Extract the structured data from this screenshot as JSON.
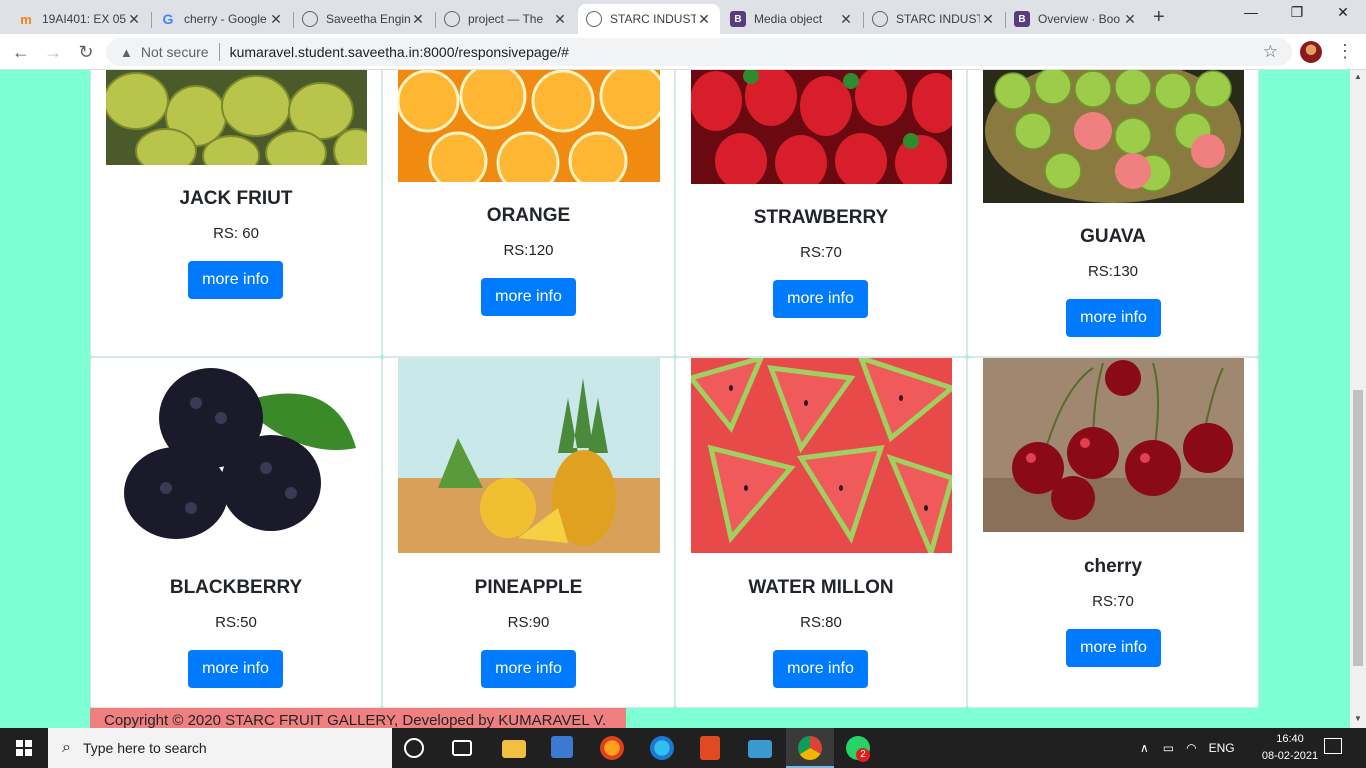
{
  "browser": {
    "tabs": [
      {
        "title": "19AI401: EX 05",
        "icon": "moodle-icon"
      },
      {
        "title": "cherry - Google",
        "icon": "google-icon"
      },
      {
        "title": "Saveetha Engin",
        "icon": "globe-icon"
      },
      {
        "title": "project — The",
        "icon": "globe-icon"
      },
      {
        "title": "STARC INDUST",
        "icon": "globe-icon",
        "active": true
      },
      {
        "title": "Media object",
        "icon": "bootstrap-icon"
      },
      {
        "title": "STARC INDUST",
        "icon": "globe-icon"
      },
      {
        "title": "Overview · Boo",
        "icon": "bootstrap-icon"
      }
    ],
    "security_label": "Not secure",
    "url": "kumaravel.student.saveetha.in:8000/responsivepage/#"
  },
  "products": [
    {
      "name": "JACK FRIUT",
      "price": "RS: 60",
      "button": "more info",
      "image": "jackfruit-image"
    },
    {
      "name": "ORANGE",
      "price": "RS:120",
      "button": "more info",
      "image": "orange-image"
    },
    {
      "name": "STRAWBERRY",
      "price": "RS:70",
      "button": "more info",
      "image": "strawberry-image"
    },
    {
      "name": "GUAVA",
      "price": "RS:130",
      "button": "more info",
      "image": "guava-image"
    },
    {
      "name": "BLACKBERRY",
      "price": "RS:50",
      "button": "more info",
      "image": "blackberry-image"
    },
    {
      "name": "PINEAPPLE",
      "price": "RS:90",
      "button": "more info",
      "image": "pineapple-image"
    },
    {
      "name": "WATER MILLON",
      "price": "RS:80",
      "button": "more info",
      "image": "watermelon-image"
    },
    {
      "name": "cherry",
      "price": "RS:70",
      "button": "more info",
      "image": "cherry-image"
    }
  ],
  "footer": {
    "text": "Copyright © 2020 STARC FRUIT GALLERY, Developed by KUMARAVEL V."
  },
  "taskbar": {
    "search_placeholder": "Type here to search",
    "language": "ENG",
    "time": "16:40",
    "date": "08-02-2021",
    "whatsapp_badge": "2"
  },
  "colors": {
    "page_background": "#7fffd4",
    "button": "#007bff",
    "footer": "#f08080"
  }
}
